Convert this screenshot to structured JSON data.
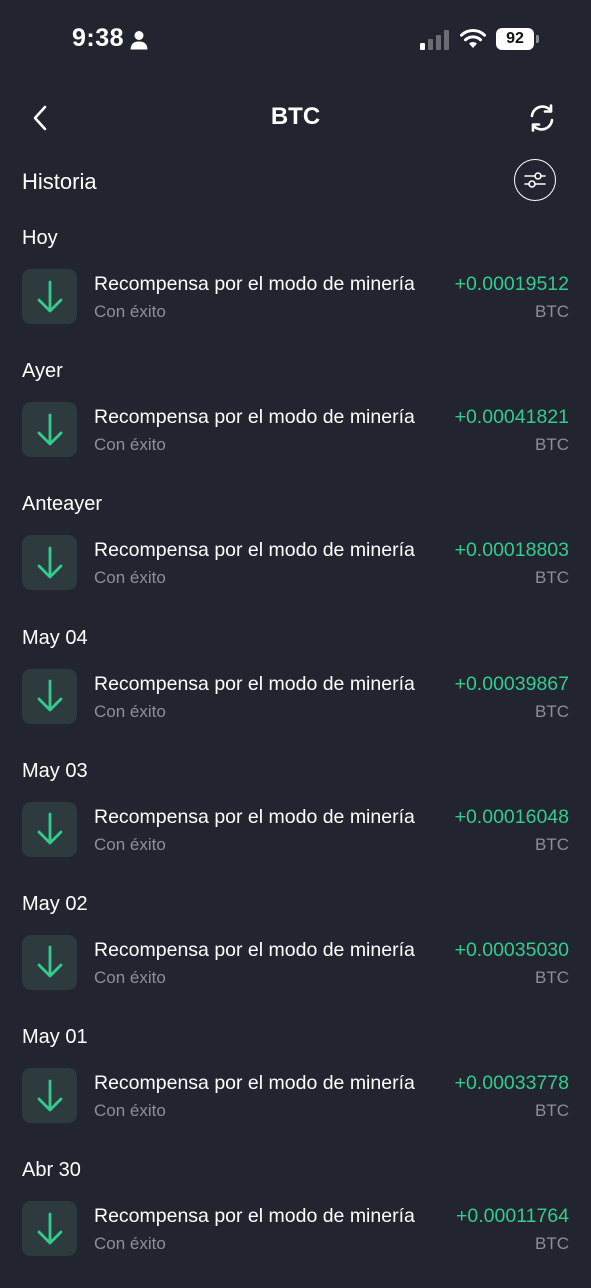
{
  "status_bar": {
    "time": "9:38",
    "battery": "92",
    "icons": [
      "person-icon",
      "signal-icon",
      "wifi-icon",
      "battery-icon"
    ]
  },
  "nav": {
    "title": "BTC",
    "back_icon": "chevron-left-icon",
    "refresh_icon": "refresh-icon"
  },
  "section": {
    "title": "Historia",
    "filter_icon": "sliders-icon"
  },
  "colors": {
    "background": "#22252f",
    "accent_green": "#33cc8c",
    "icon_tile": "#2d3b3f",
    "muted_text": "#8c8f97"
  },
  "history": [
    {
      "date": "Hoy",
      "title": "Recompensa por el modo de minería",
      "status": "Con éxito",
      "amount": "+0.00019512",
      "currency": "BTC",
      "icon": "arrow-down-icon"
    },
    {
      "date": "Ayer",
      "title": "Recompensa por el modo de minería",
      "status": "Con éxito",
      "amount": "+0.00041821",
      "currency": "BTC",
      "icon": "arrow-down-icon"
    },
    {
      "date": "Anteayer",
      "title": "Recompensa por el modo de minería",
      "status": "Con éxito",
      "amount": "+0.00018803",
      "currency": "BTC",
      "icon": "arrow-down-icon"
    },
    {
      "date": "May 04",
      "title": "Recompensa por el modo de minería",
      "status": "Con éxito",
      "amount": "+0.00039867",
      "currency": "BTC",
      "icon": "arrow-down-icon"
    },
    {
      "date": "May 03",
      "title": "Recompensa por el modo de minería",
      "status": "Con éxito",
      "amount": "+0.00016048",
      "currency": "BTC",
      "icon": "arrow-down-icon"
    },
    {
      "date": "May 02",
      "title": "Recompensa por el modo de minería",
      "status": "Con éxito",
      "amount": "+0.00035030",
      "currency": "BTC",
      "icon": "arrow-down-icon"
    },
    {
      "date": "May 01",
      "title": "Recompensa por el modo de minería",
      "status": "Con éxito",
      "amount": "+0.00033778",
      "currency": "BTC",
      "icon": "arrow-down-icon"
    },
    {
      "date": "Abr 30",
      "title": "Recompensa por el modo de minería",
      "status": "Con éxito",
      "amount": "+0.00011764",
      "currency": "BTC",
      "icon": "arrow-down-icon"
    }
  ]
}
